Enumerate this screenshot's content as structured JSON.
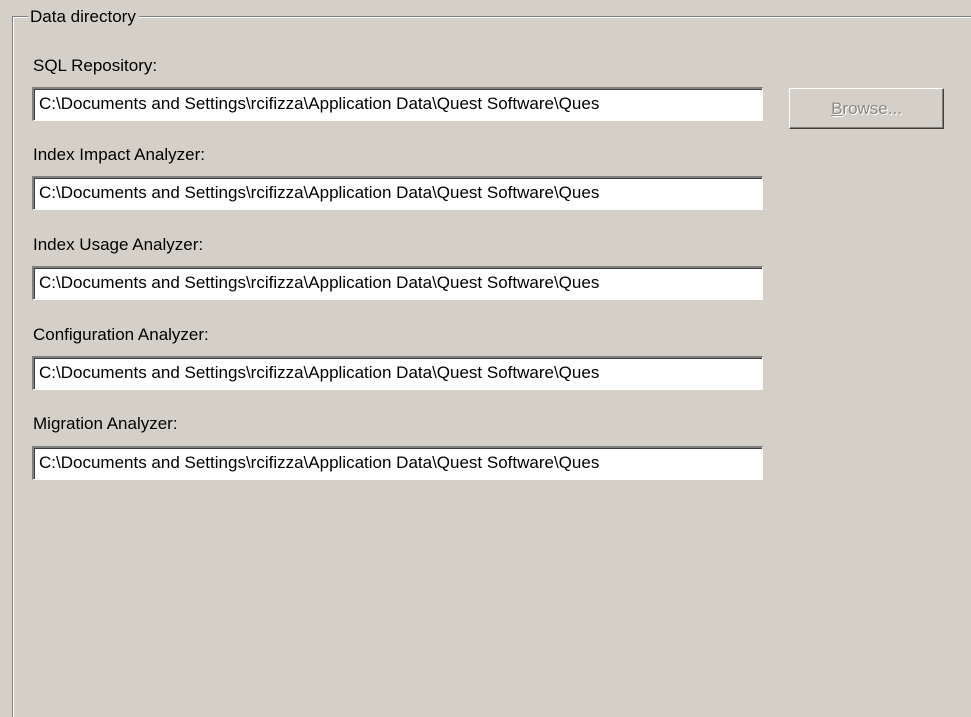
{
  "groupbox": {
    "title": "Data directory"
  },
  "fields": [
    {
      "label": "SQL Repository:",
      "value": "C:\\Documents and Settings\\rcifizza\\Application Data\\Quest Software\\Ques"
    },
    {
      "label": "Index Impact Analyzer:",
      "value": "C:\\Documents and Settings\\rcifizza\\Application Data\\Quest Software\\Ques"
    },
    {
      "label": "Index Usage Analyzer:",
      "value": "C:\\Documents and Settings\\rcifizza\\Application Data\\Quest Software\\Ques"
    },
    {
      "label": "Configuration Analyzer:",
      "value": "C:\\Documents and Settings\\rcifizza\\Application Data\\Quest Software\\Ques"
    },
    {
      "label": "Migration Analyzer:",
      "value": "C:\\Documents and Settings\\rcifizza\\Application Data\\Quest Software\\Ques"
    }
  ],
  "browse_button": {
    "label": "Browse...",
    "mnemonic": "B",
    "rest": "rowse...",
    "enabled": false
  }
}
